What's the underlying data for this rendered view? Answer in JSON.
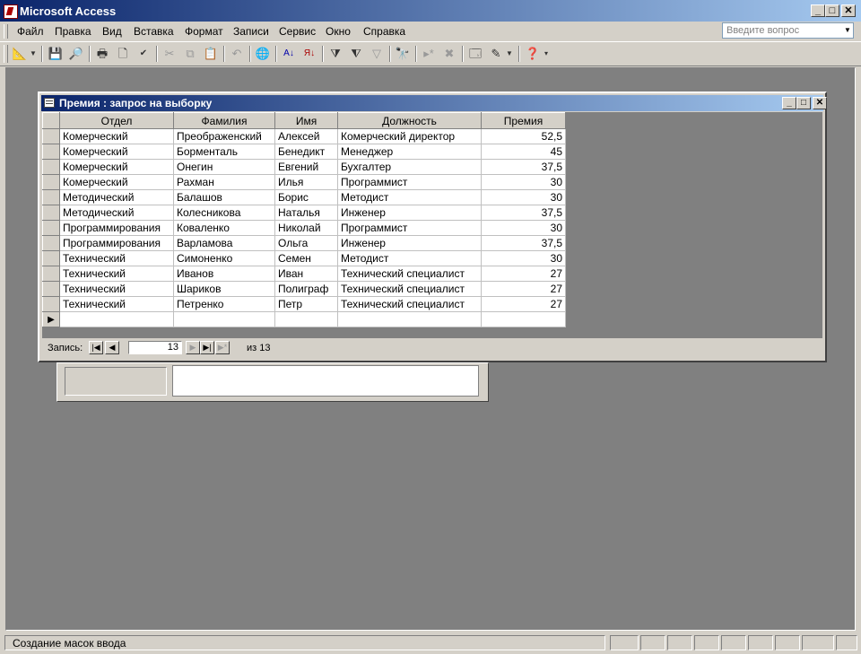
{
  "app": {
    "title": "Microsoft Access"
  },
  "menu": [
    {
      "label": "Файл"
    },
    {
      "label": "Правка"
    },
    {
      "label": "Вид"
    },
    {
      "label": "Вставка"
    },
    {
      "label": "Формат"
    },
    {
      "label": "Записи"
    },
    {
      "label": "Сервис"
    },
    {
      "label": "Окно"
    },
    {
      "label": "Справка"
    }
  ],
  "help_box": {
    "placeholder": "Введите вопрос"
  },
  "toolbar": {
    "icons": [
      "design-view-icon",
      "save-icon",
      "print-icon",
      "print-preview-icon",
      "spelling-icon",
      "cut-icon",
      "copy-icon",
      "paste-icon",
      "undo-icon",
      "hyperlink-icon",
      "sort-asc-icon",
      "sort-desc-icon",
      "filter-by-selection-icon",
      "filter-by-form-icon",
      "apply-filter-icon",
      "find-icon",
      "new-record-icon",
      "delete-record-icon",
      "database-window-icon",
      "new-object-icon",
      "help-icon"
    ]
  },
  "query_window": {
    "title": "Премия : запрос на выборку",
    "columns": [
      "Отдел",
      "Фамилия",
      "Имя",
      "Должность",
      "Премия"
    ],
    "rows": [
      [
        "Комерческий",
        "Преображенский",
        "Алексей",
        "Комерческий директор",
        "52,5"
      ],
      [
        "Комерческий",
        "Борменталь",
        "Бенедикт",
        "Менеджер",
        "45"
      ],
      [
        "Комерческий",
        "Онегин",
        "Евгений",
        "Бухгалтер",
        "37,5"
      ],
      [
        "Комерческий",
        "Рахман",
        "Илья",
        "Программист",
        "30"
      ],
      [
        "Методический",
        "Балашов",
        "Борис",
        "Методист",
        "30"
      ],
      [
        "Методический",
        "Колесникова",
        "Наталья",
        "Инженер",
        "37,5"
      ],
      [
        "Программирования",
        "Коваленко",
        "Николай",
        "Программист",
        "30"
      ],
      [
        "Программирования",
        "Варламова",
        "Ольга",
        "Инженер",
        "37,5"
      ],
      [
        "Технический",
        "Симоненко",
        "Семен",
        "Методист",
        "30"
      ],
      [
        "Технический",
        "Иванов",
        "Иван",
        "Технический специалист",
        "27"
      ],
      [
        "Технический",
        "Шариков",
        "Полиграф",
        "Технический специалист",
        "27"
      ],
      [
        "Технический",
        "Петренко",
        "Петр",
        "Технический специалист",
        "27"
      ]
    ],
    "navigation": {
      "label": "Запись:",
      "current": "13",
      "of_label": "из",
      "total": "13"
    }
  },
  "status": {
    "text": "Создание масок ввода"
  }
}
